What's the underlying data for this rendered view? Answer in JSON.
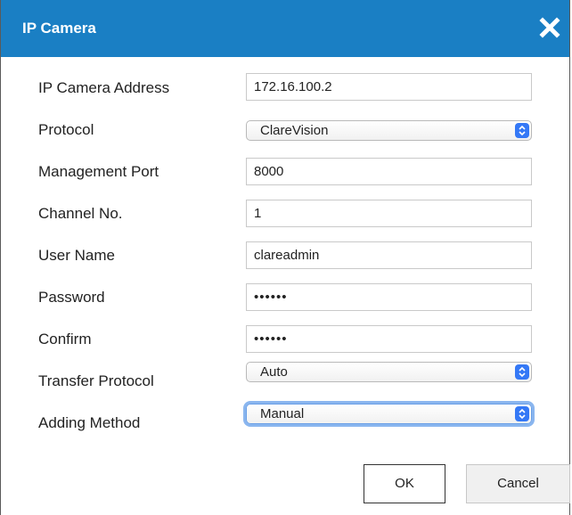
{
  "dialog": {
    "title": "IP Camera",
    "close_icon": "close-icon",
    "title_color": "#1a7fc4"
  },
  "form": {
    "ip_address": {
      "label": "IP Camera Address",
      "value": "172.16.100.2"
    },
    "protocol": {
      "label": "Protocol",
      "value": "ClareVision"
    },
    "management_port": {
      "label": "Management Port",
      "value": "8000"
    },
    "channel": {
      "label": "Channel No.",
      "value": "1"
    },
    "user_name": {
      "label": "User Name",
      "value": "clareadmin"
    },
    "password": {
      "label": "Password",
      "value": "••••••"
    },
    "confirm": {
      "label": "Confirm",
      "value": "••••••"
    },
    "transfer_protocol": {
      "label": "Transfer Protocol",
      "value": "Auto"
    },
    "adding_method": {
      "label": "Adding Method",
      "value": "Manual"
    }
  },
  "buttons": {
    "ok": "OK",
    "cancel": "Cancel"
  },
  "icons": {
    "select_stepper": "up-down-chevron-icon"
  }
}
